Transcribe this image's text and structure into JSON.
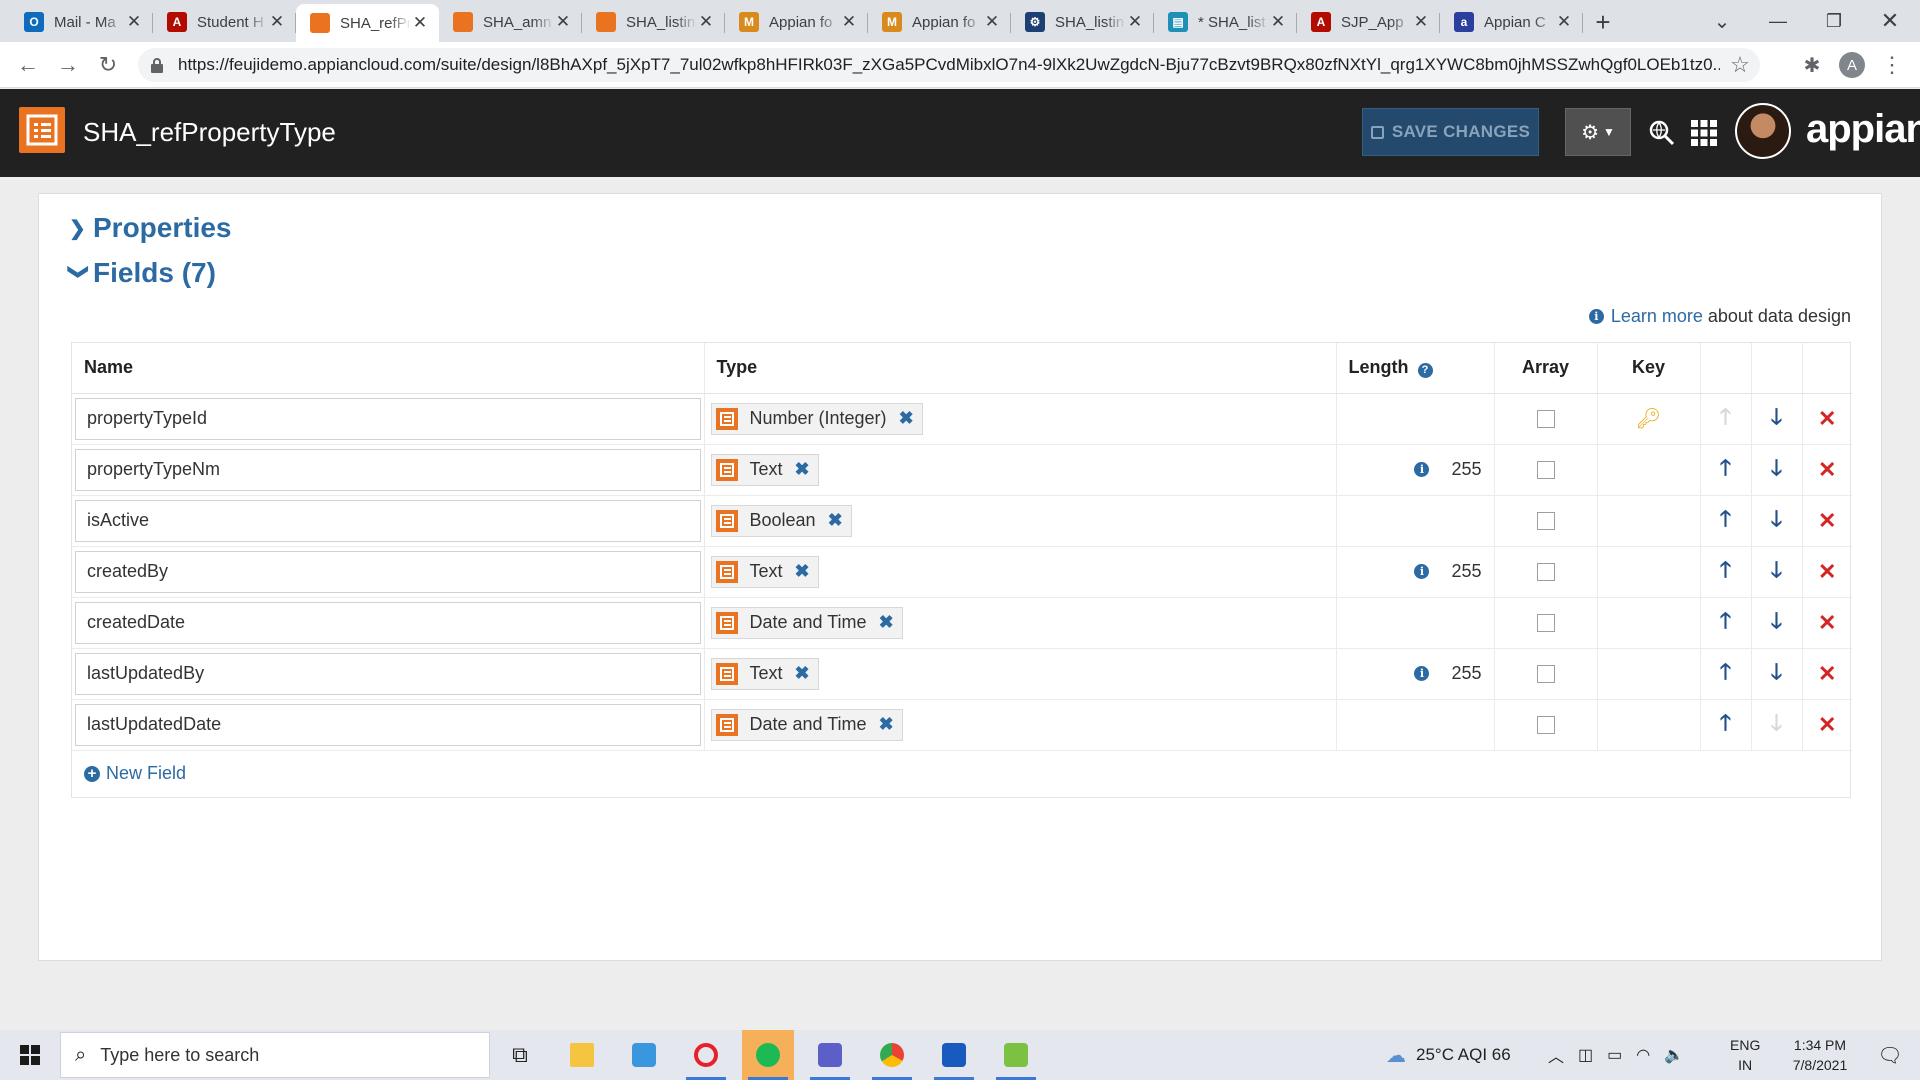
{
  "browser": {
    "tabs": [
      {
        "label": "Mail - Ma",
        "icon": "outlook-icon",
        "color": "#0f6cbd",
        "glyph": "O"
      },
      {
        "label": "Student H",
        "icon": "acrobat-icon",
        "color": "#b30b00",
        "glyph": "A"
      },
      {
        "label": "SHA_refPr",
        "icon": "appian-record-icon",
        "color": "#ea7321",
        "glyph": "",
        "active": true
      },
      {
        "label": "SHA_amn",
        "icon": "appian-record-icon",
        "color": "#ea7321",
        "glyph": ""
      },
      {
        "label": "SHA_listin",
        "icon": "appian-record-icon",
        "color": "#ea7321",
        "glyph": ""
      },
      {
        "label": "Appian fo",
        "icon": "pma-icon",
        "color": "#d88a1c",
        "glyph": "M"
      },
      {
        "label": "Appian fo",
        "icon": "pma-icon",
        "color": "#d88a1c",
        "glyph": "M"
      },
      {
        "label": "SHA_listin",
        "icon": "process-model-icon",
        "color": "#1d3f73",
        "glyph": "⚙"
      },
      {
        "label": "* SHA_list",
        "icon": "interface-icon",
        "color": "#1f8fb6",
        "glyph": "▤"
      },
      {
        "label": "SJP_App",
        "icon": "acrobat-icon",
        "color": "#b30b00",
        "glyph": "A"
      },
      {
        "label": "Appian C",
        "icon": "appian-community-icon",
        "color": "#2b3f9e",
        "glyph": "a"
      }
    ],
    "url": "https://feujidemo.appiancloud.com/suite/design/l8BhAXpf_5jXpT7_7ul02wfkp8hHFIRk03F_zXGa5PCvdMibxlO7n4-9lXk2UwZgdcN-Bju77cBzvt9BRQx80zfNXtYl_qrg1XYWC8bm0jhMSSZwhQgf0LOEb1tz0...",
    "profile_initial": "A"
  },
  "app": {
    "title": "SHA_refPropertyType",
    "save_label": "SAVE CHANGES",
    "brand": "appian"
  },
  "main": {
    "properties_label": "Properties",
    "fields_label": "Fields (7)",
    "learn_more_link": "Learn more",
    "learn_more_suffix": "about data design",
    "columns": {
      "name": "Name",
      "type": "Type",
      "length": "Length",
      "array": "Array",
      "key": "Key"
    },
    "fields": [
      {
        "name": "propertyTypeId",
        "type": "Number (Integer)",
        "length": "",
        "array": false,
        "key": true,
        "up_enabled": false,
        "down_enabled": true
      },
      {
        "name": "propertyTypeNm",
        "type": "Text",
        "length": "255",
        "array": false,
        "key": false,
        "up_enabled": true,
        "down_enabled": true
      },
      {
        "name": "isActive",
        "type": "Boolean",
        "length": "",
        "array": false,
        "key": false,
        "up_enabled": true,
        "down_enabled": true
      },
      {
        "name": "createdBy",
        "type": "Text",
        "length": "255",
        "array": false,
        "key": false,
        "up_enabled": true,
        "down_enabled": true
      },
      {
        "name": "createdDate",
        "type": "Date and Time",
        "length": "",
        "array": false,
        "key": false,
        "up_enabled": true,
        "down_enabled": true
      },
      {
        "name": "lastUpdatedBy",
        "type": "Text",
        "length": "255",
        "array": false,
        "key": false,
        "up_enabled": true,
        "down_enabled": true
      },
      {
        "name": "lastUpdatedDate",
        "type": "Date and Time",
        "length": "",
        "array": false,
        "key": false,
        "up_enabled": true,
        "down_enabled": false
      }
    ],
    "new_field_label": "New Field"
  },
  "taskbar": {
    "search_placeholder": "Type here to search",
    "weather": "25°C  AQI 66",
    "lang_top": "ENG",
    "lang_bottom": "IN",
    "time": "1:34 PM",
    "date": "7/8/2021"
  },
  "colors": {
    "appian_orange": "#ea7321",
    "header_bg": "#212121",
    "link_blue": "#2c6aa3",
    "save_bg": "#23496d",
    "delete_red": "#d42525",
    "key_yellow": "#e8a90c"
  }
}
